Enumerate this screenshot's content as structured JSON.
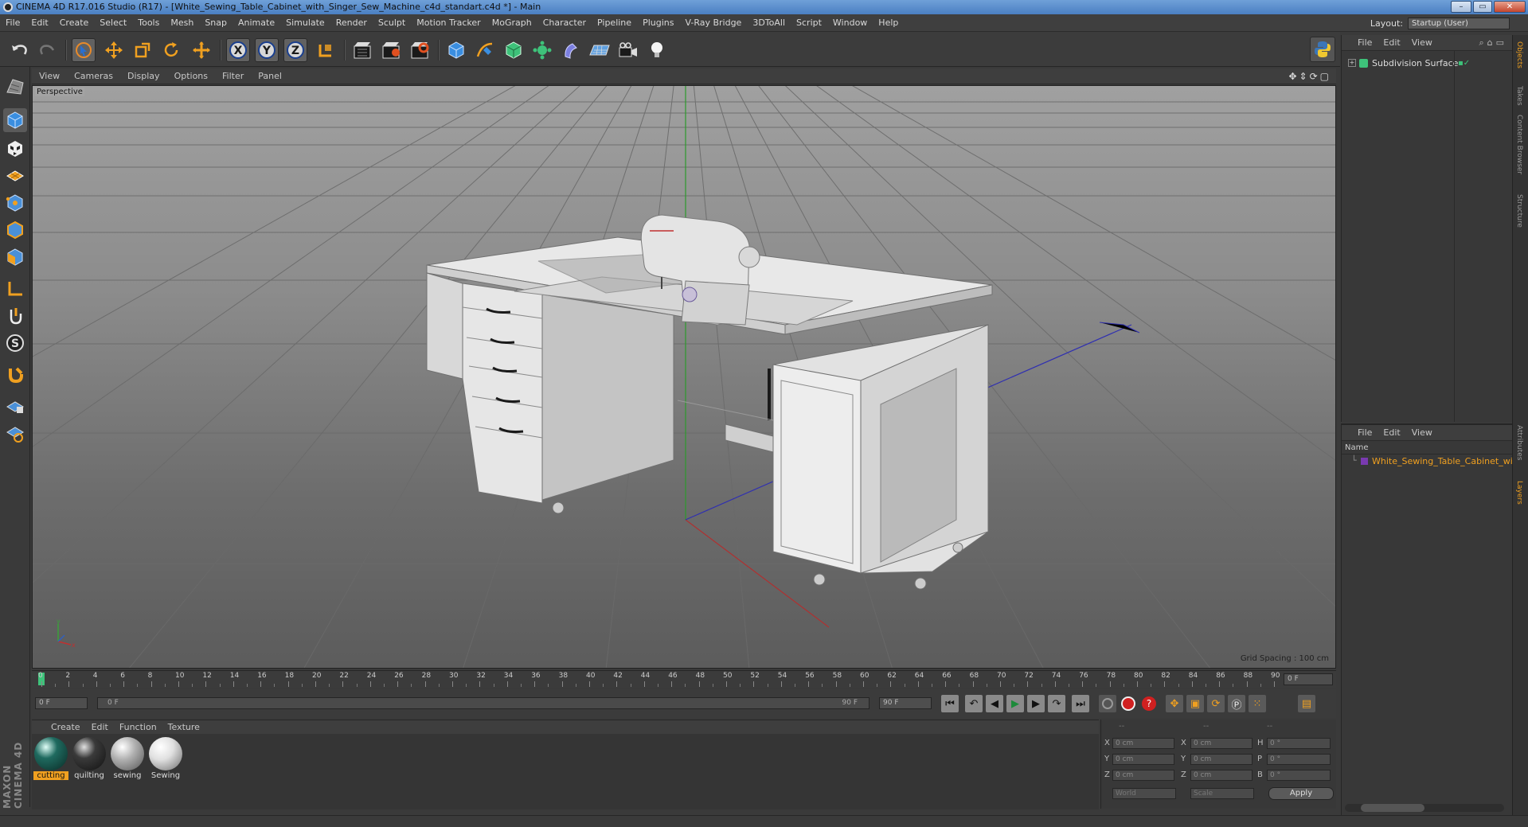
{
  "titlebar": {
    "title": "CINEMA 4D R17.016 Studio (R17) - [White_Sewing_Table_Cabinet_with_Singer_Sew_Machine_c4d_standart.c4d *] - Main"
  },
  "menubar": {
    "items": [
      "File",
      "Edit",
      "Create",
      "Select",
      "Tools",
      "Mesh",
      "Snap",
      "Animate",
      "Simulate",
      "Render",
      "Sculpt",
      "Motion Tracker",
      "MoGraph",
      "Character",
      "Pipeline",
      "Plugins",
      "V-Ray Bridge",
      "3DToAll",
      "Script",
      "Window",
      "Help"
    ],
    "layout_label": "Layout:",
    "layout_value": "Startup (User)"
  },
  "viewport": {
    "menu": [
      "View",
      "Cameras",
      "Display",
      "Options",
      "Filter",
      "Panel"
    ],
    "camera_label": "Perspective",
    "grid_spacing": "Grid Spacing : 100 cm"
  },
  "timeline": {
    "ticks": [
      "0",
      "2",
      "4",
      "6",
      "8",
      "10",
      "12",
      "14",
      "16",
      "18",
      "20",
      "22",
      "24",
      "26",
      "28",
      "30",
      "32",
      "34",
      "36",
      "38",
      "40",
      "42",
      "44",
      "46",
      "48",
      "50",
      "52",
      "54",
      "56",
      "58",
      "60",
      "62",
      "64",
      "66",
      "68",
      "70",
      "72",
      "74",
      "76",
      "78",
      "80",
      "82",
      "84",
      "86",
      "88",
      "90"
    ],
    "current_frame": "0 F",
    "start_field": "0 F",
    "range_start": "0 F",
    "range_end": "90 F",
    "end_field": "90 F"
  },
  "materials": {
    "menu": [
      "Create",
      "Edit",
      "Function",
      "Texture"
    ],
    "items": [
      {
        "name": "cutting",
        "color": "#1f6a5f"
      },
      {
        "name": "quilting",
        "color": "#3a3a3a"
      },
      {
        "name": "sewing",
        "color": "#b0b0b0"
      },
      {
        "name": "Sewing",
        "color": "#e0e0e0"
      }
    ]
  },
  "coordinates": {
    "header": [
      "--",
      "--",
      "--"
    ],
    "rows": [
      {
        "axis": "X",
        "pos": "0 cm",
        "axis2": "X",
        "size": "0 cm",
        "rot_axis": "H",
        "rot": "0 °"
      },
      {
        "axis": "Y",
        "pos": "0 cm",
        "axis2": "Y",
        "size": "0 cm",
        "rot_axis": "P",
        "rot": "0 °"
      },
      {
        "axis": "Z",
        "pos": "0 cm",
        "axis2": "Z",
        "size": "0 cm",
        "rot_axis": "B",
        "rot": "0 °"
      }
    ],
    "mode_world": "World",
    "mode_scale": "Scale",
    "apply": "Apply"
  },
  "object_manager": {
    "menu": [
      "File",
      "Edit",
      "View"
    ],
    "objects": [
      {
        "name": "Subdivision Surface"
      }
    ]
  },
  "layer_manager": {
    "menu": [
      "File",
      "Edit",
      "View"
    ],
    "column_name": "Name",
    "layers": [
      {
        "name": "White_Sewing_Table_Cabinet_wit"
      }
    ]
  },
  "side_tabs": [
    "Objects",
    "Takes",
    "Content Browser",
    "Structure",
    "Attributes",
    "Layers"
  ],
  "brand": "MAXON CINEMA 4D"
}
